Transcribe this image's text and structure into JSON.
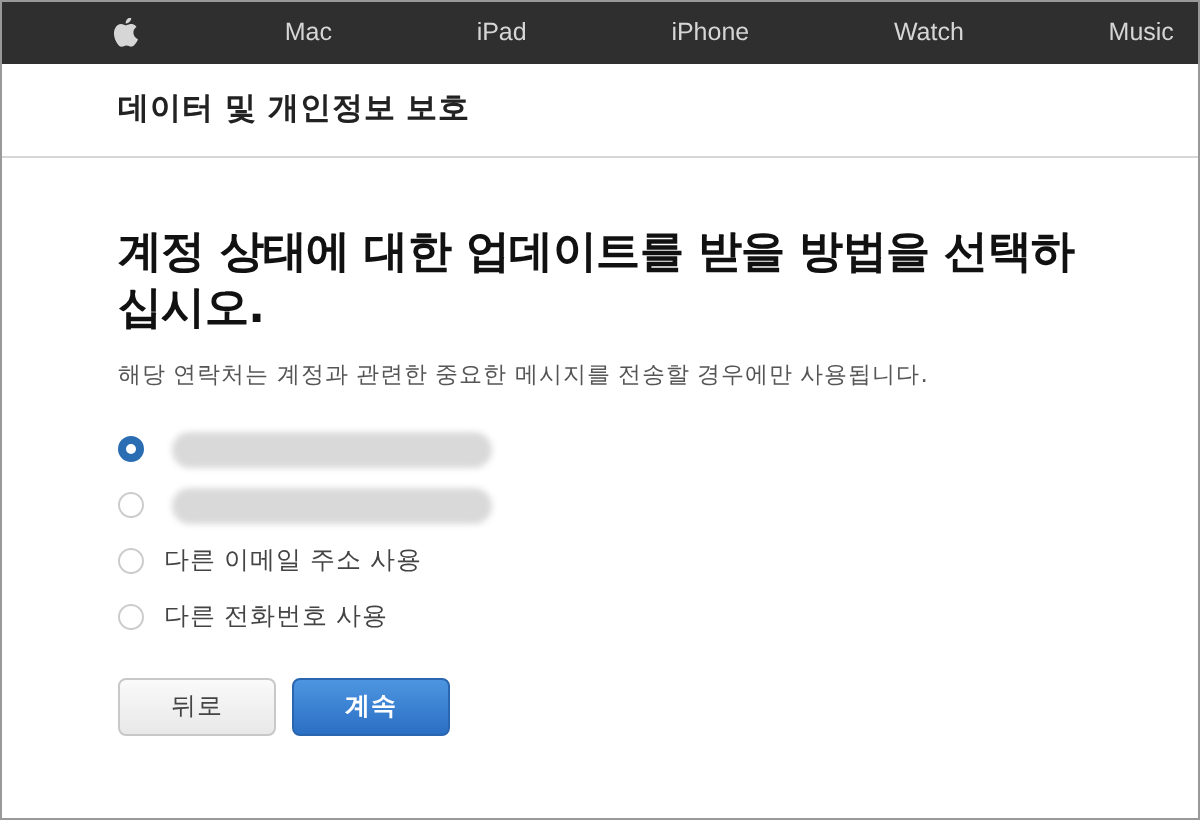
{
  "nav": {
    "items": [
      {
        "label": "Mac"
      },
      {
        "label": "iPad"
      },
      {
        "label": "iPhone"
      },
      {
        "label": "Watch"
      },
      {
        "label": "Music"
      }
    ]
  },
  "section_title": "데이터 및 개인정보 보호",
  "heading": "계정 상태에 대한 업데이트를 받을 방법을 선택하십시오.",
  "description": "해당 연락처는 계정과 관련한 중요한 메시지를 전송할 경우에만 사용됩니다.",
  "options": [
    {
      "redacted": true,
      "selected": true
    },
    {
      "redacted": true,
      "selected": false
    },
    {
      "label": "다른 이메일 주소 사용",
      "selected": false
    },
    {
      "label": "다른 전화번호 사용",
      "selected": false
    }
  ],
  "buttons": [
    {
      "label": "뒤로",
      "kind": "secondary"
    },
    {
      "label": "계속",
      "kind": "primary"
    }
  ]
}
